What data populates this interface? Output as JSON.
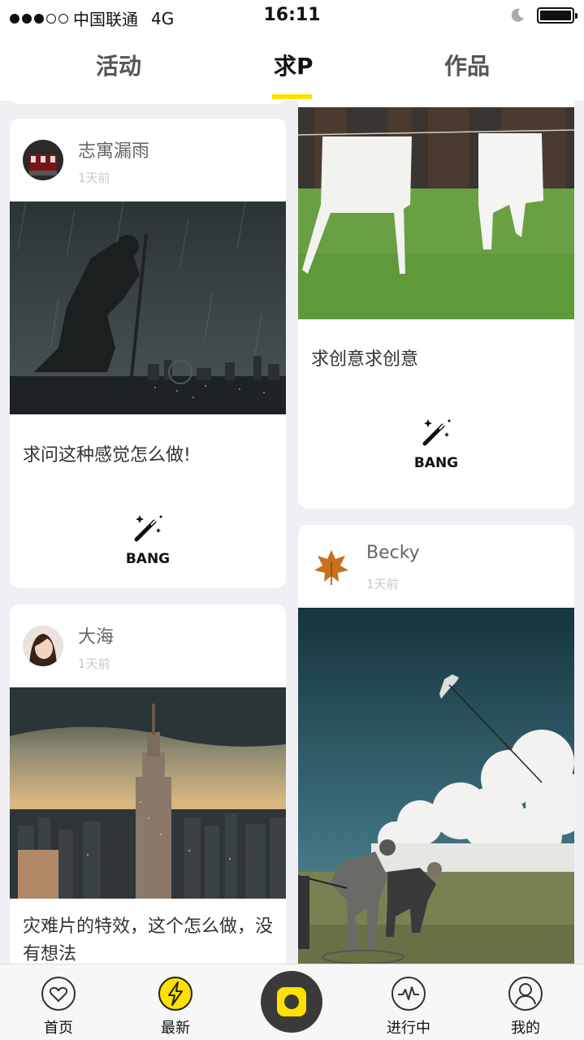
{
  "status_bar": {
    "carrier": "中国联通",
    "network": "4G",
    "time": "16:11",
    "signal_bars_filled": 3,
    "signal_bars_total": 5
  },
  "nav": {
    "tabs": [
      {
        "label": "活动"
      },
      {
        "label": "求P"
      },
      {
        "label": "作品"
      }
    ],
    "active_tab": "求P"
  },
  "feed": {
    "bang_label": "BANG",
    "posts": [
      {
        "user": "志寓漏雨",
        "time": "1天前",
        "caption": "求问这种感觉怎么做!",
        "image": "man-kneeling-in-rain-photo"
      },
      {
        "user": "",
        "time": "",
        "caption": "求创意求创意",
        "image": "shirts-on-clothesline-photo"
      },
      {
        "user": "大海",
        "time": "1天前",
        "caption": "灾难片的特效，这个怎么做，没有想法",
        "image": "city-skyline-storm-photo"
      },
      {
        "user": "Becky",
        "time": "1天前",
        "caption": "",
        "image": "men-flying-kite-person-photo"
      }
    ]
  },
  "tabbar": {
    "items": [
      {
        "label": "首页",
        "icon": "heart-icon"
      },
      {
        "label": "最新",
        "icon": "lightning-icon"
      },
      {
        "label": "",
        "icon": "camera-icon"
      },
      {
        "label": "进行中",
        "icon": "pulse-icon"
      },
      {
        "label": "我的",
        "icon": "person-icon"
      }
    ]
  },
  "colors": {
    "accent": "#ffe100",
    "background": "#efeff4",
    "center_button": "#3a3a3a"
  }
}
